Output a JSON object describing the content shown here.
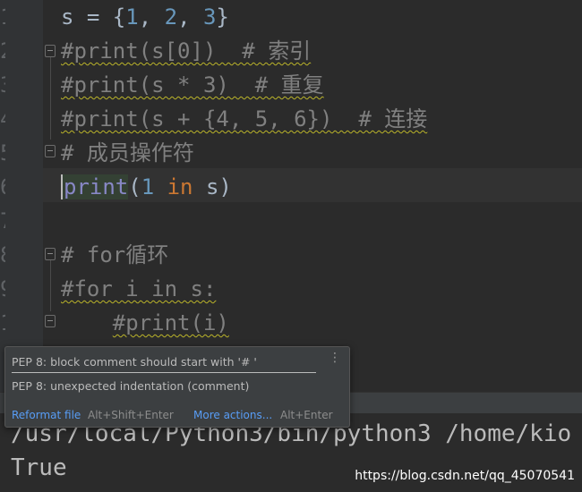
{
  "editor": {
    "lines": [
      {
        "id": "l1",
        "text": "s = {1, 2, 3}"
      },
      {
        "id": "l2",
        "text": "#print(s[0])  # 索引"
      },
      {
        "id": "l3",
        "text": "#print(s * 3)  # 重复"
      },
      {
        "id": "l4",
        "text": "#print(s + {4, 5, 6})  # 连接"
      },
      {
        "id": "l5",
        "text": "# 成员操作符"
      },
      {
        "id": "l6",
        "text": "print(1 in s)"
      },
      {
        "id": "l7",
        "text": ""
      },
      {
        "id": "l8",
        "text": "# for循环"
      },
      {
        "id": "l9",
        "text": "#for i in s:"
      },
      {
        "id": "l10",
        "text": "    #print(i)"
      }
    ],
    "tokens": {
      "l1_a": "s = {",
      "l1_b": "1",
      "l1_c": ", ",
      "l1_d": "2",
      "l1_e": ", ",
      "l1_f": "3",
      "l1_g": "}",
      "l6_a": "print",
      "l6_b": "(",
      "l6_c": "1",
      "l6_d": " ",
      "l6_e": "in",
      "l6_f": " s)",
      "l10_indent": "    ",
      "l10_code": "#print(i)"
    }
  },
  "popup": {
    "message_1": "PEP 8: block comment should start with '# '",
    "message_2": "PEP 8: unexpected indentation (comment)",
    "reformat_label": "Reformat file",
    "reformat_shortcut": "Alt+Shift+Enter",
    "more_actions_label": "More actions...",
    "more_actions_shortcut": "Alt+Enter",
    "menu_icon": "⋮"
  },
  "console": {
    "line_1": "/usr/local/Python3/bin/python3 /home/kio",
    "line_2": "True"
  },
  "watermark": "https://blog.csdn.net/qq_45070541",
  "colors": {
    "background": "#2b2b2b",
    "keyword": "#cc7832",
    "number": "#6897bb",
    "builtin": "#8888c6",
    "comment": "#808080",
    "link": "#589df6"
  }
}
